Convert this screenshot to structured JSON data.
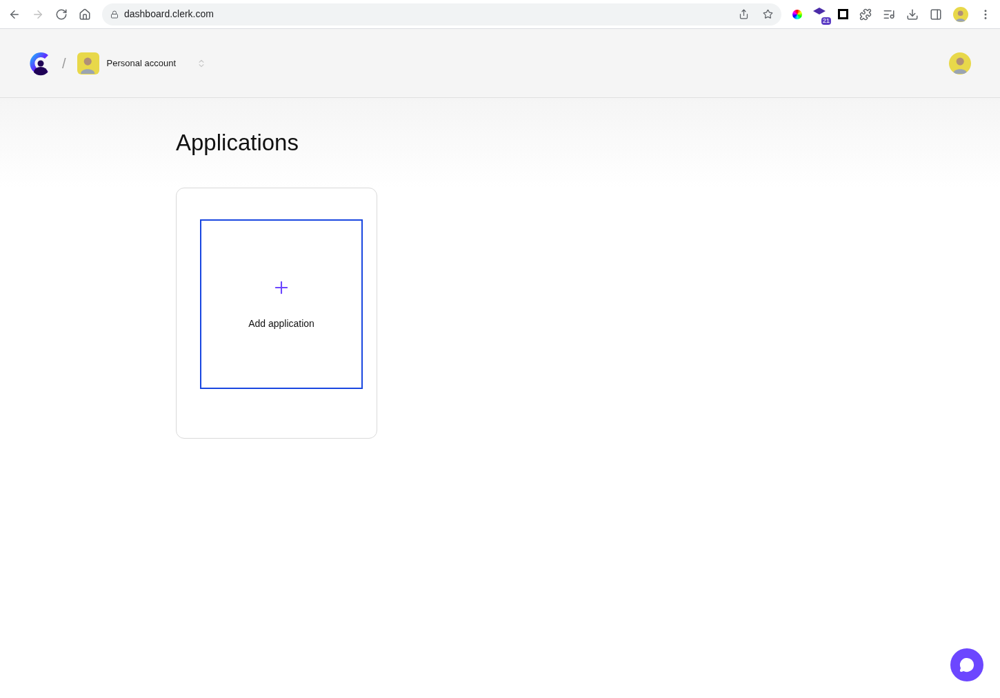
{
  "browser": {
    "url": "dashboard.clerk.com",
    "extension_badge": "21"
  },
  "header": {
    "separator": "/",
    "account": "Personal account"
  },
  "page": {
    "title": "Applications",
    "add_card": {
      "label": "Add application",
      "focused": true
    }
  }
}
